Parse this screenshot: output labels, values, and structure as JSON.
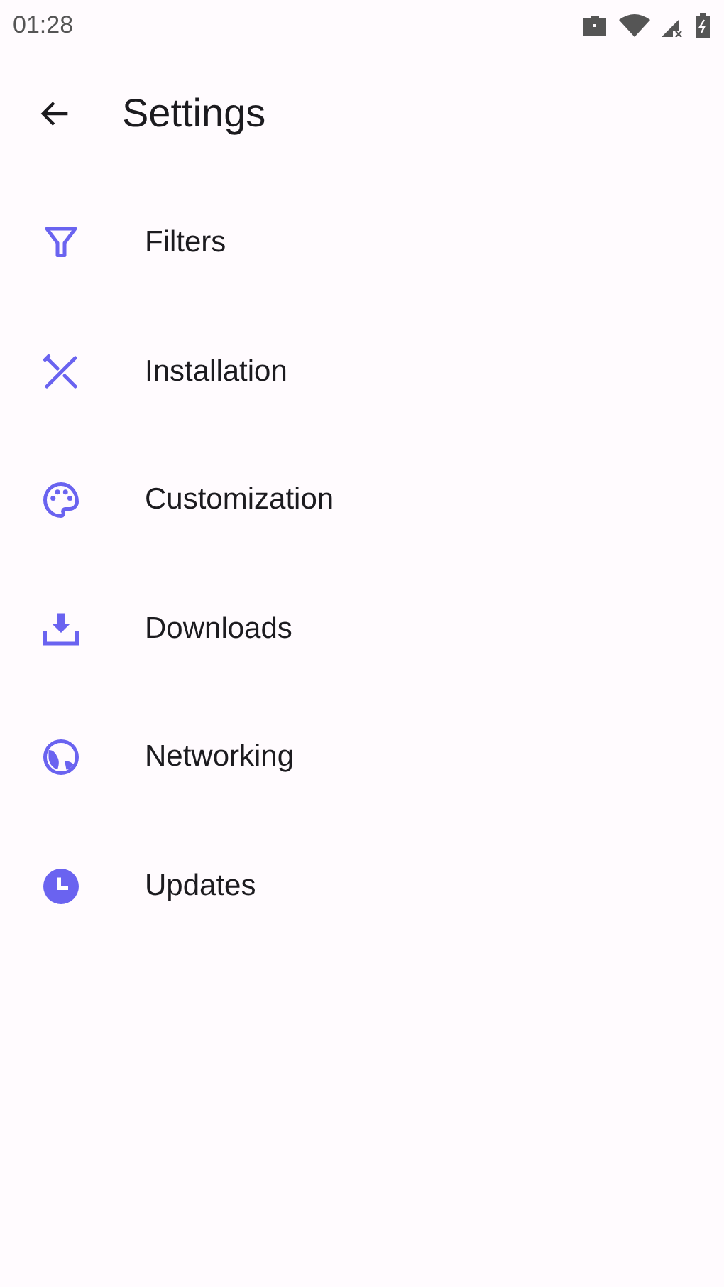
{
  "status_bar": {
    "time": "01:28"
  },
  "app_bar": {
    "title": "Settings"
  },
  "items": [
    {
      "label": "Filters"
    },
    {
      "label": "Installation"
    },
    {
      "label": "Customization"
    },
    {
      "label": "Downloads"
    },
    {
      "label": "Networking"
    },
    {
      "label": "Updates"
    }
  ]
}
